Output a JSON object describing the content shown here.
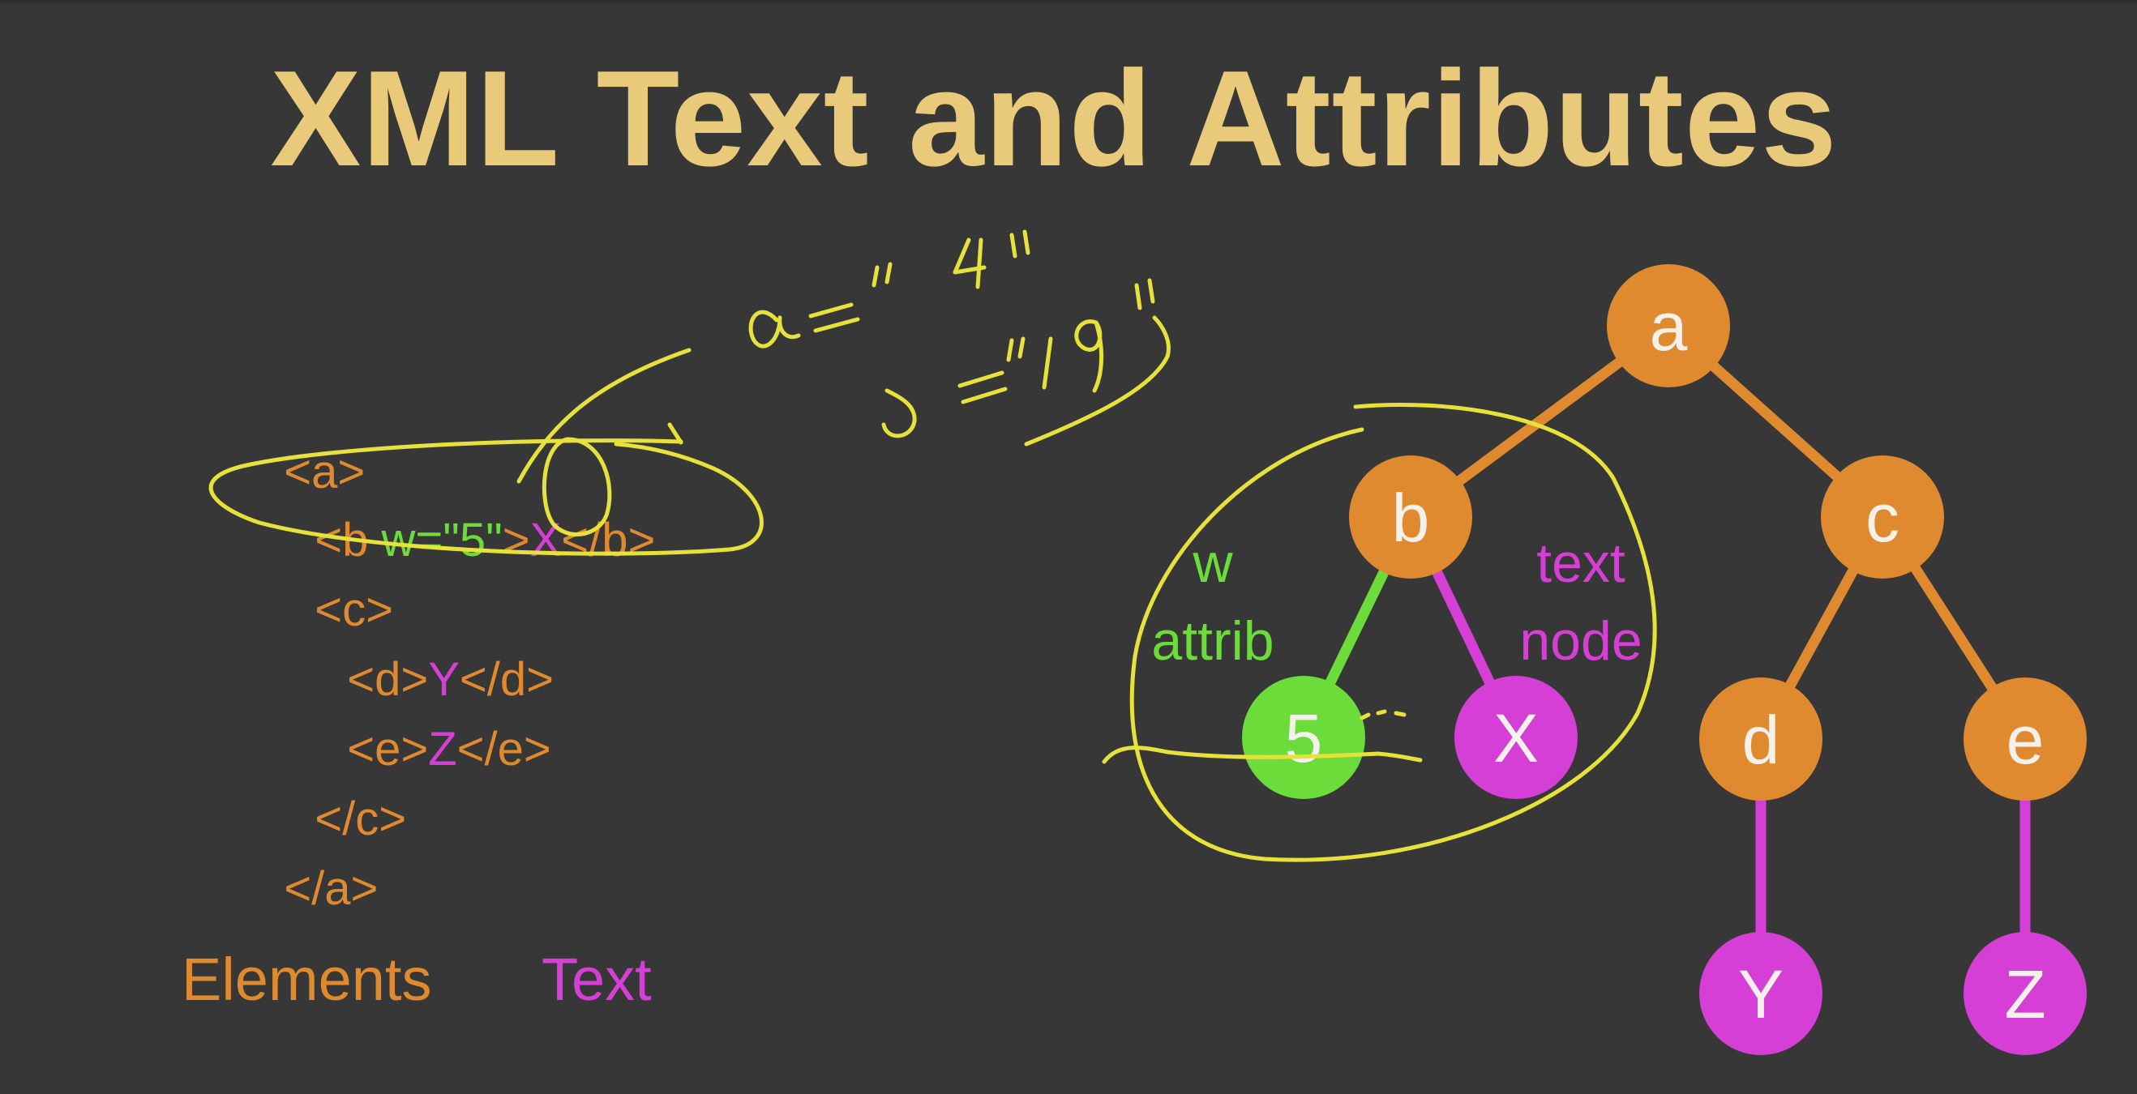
{
  "title": "XML Text and Attributes",
  "code": {
    "l1": "<a>",
    "l2_open": "<b ",
    "l2_attr": "w=\"5\"",
    "l2_gt": ">",
    "l2_text": "X",
    "l2_close": "</b>",
    "l3": "<c>",
    "l4_open": "<d>",
    "l4_text": "Y",
    "l4_close": "</d>",
    "l5_open": "<e>",
    "l5_text": "Z",
    "l5_close": "</e>",
    "l6": "</c>",
    "l7": "</a>"
  },
  "legend": {
    "elements": "Elements",
    "text": "Text"
  },
  "tree": {
    "nodes": {
      "a": "a",
      "b": "b",
      "c": "c",
      "d": "d",
      "e": "e",
      "w_value": "5",
      "x": "X",
      "y": "Y",
      "z": "Z"
    },
    "attrib_label_line1": "w",
    "attrib_label_line2": "attrib",
    "text_label_line1": "text",
    "text_label_line2": "node"
  },
  "colors": {
    "background": "#373737",
    "title": "#e9c97a",
    "element": "#e08a30",
    "attribute": "#6cdc3a",
    "text": "#d63fd6",
    "annotation": "#e6e23a"
  }
}
